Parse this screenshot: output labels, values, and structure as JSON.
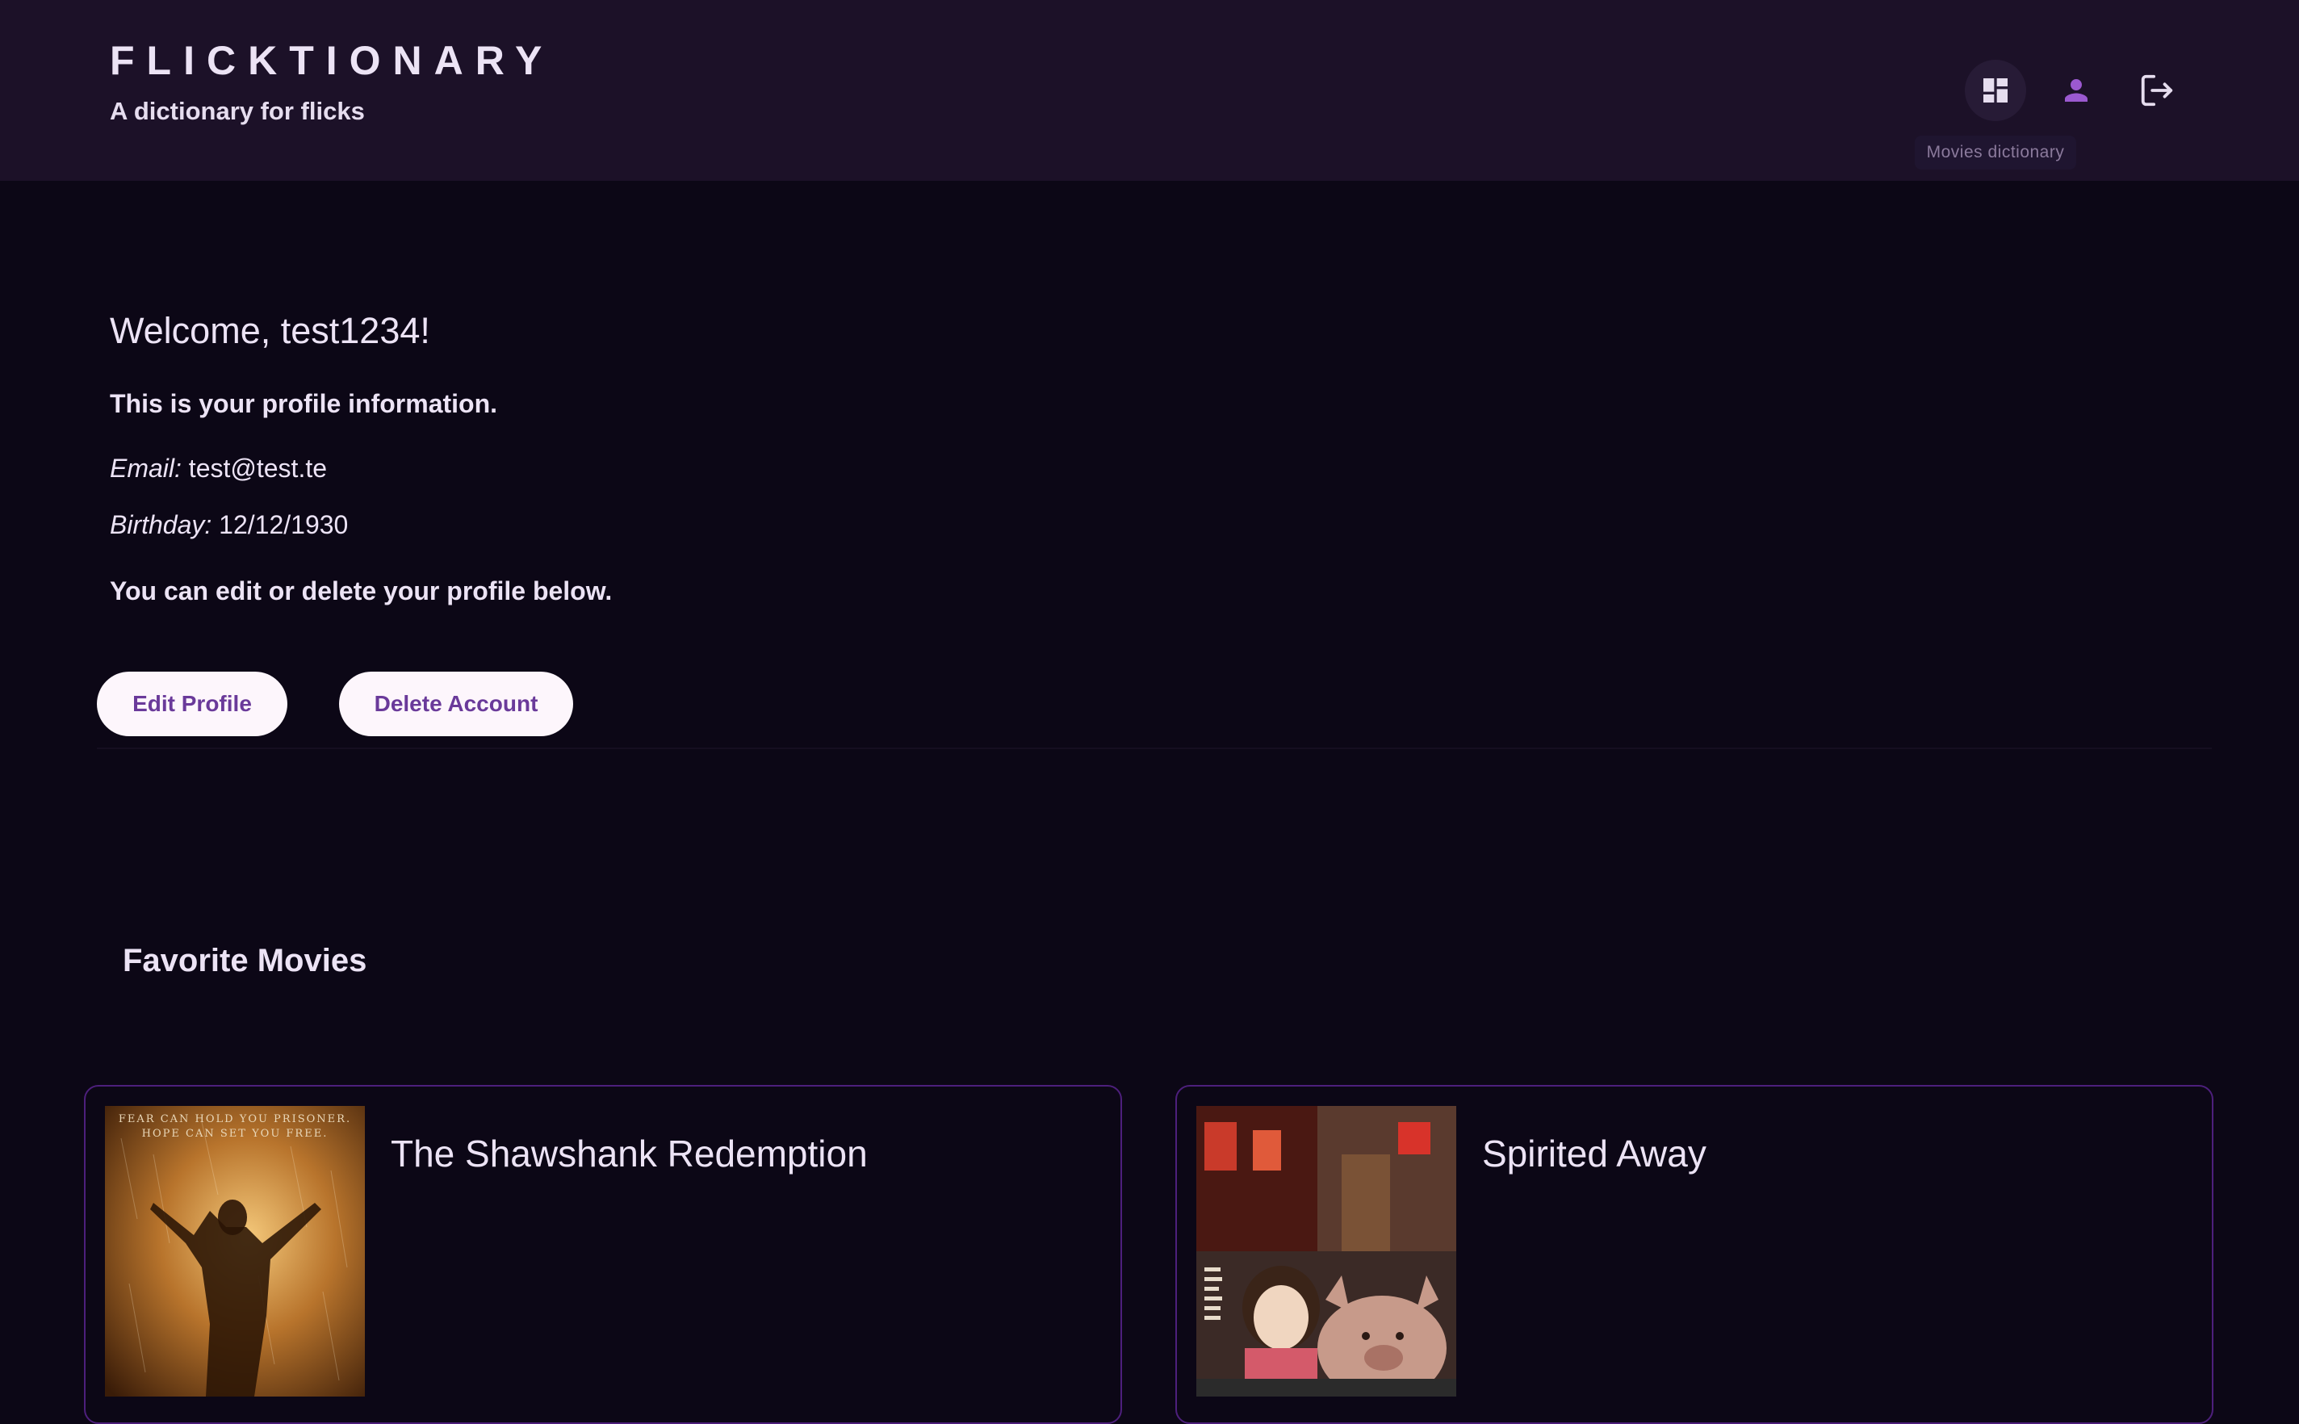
{
  "header": {
    "title": "FLICKTIONARY",
    "subtitle": "A dictionary for flicks",
    "nav": [
      {
        "icon": "dashboard-icon",
        "active": true
      },
      {
        "icon": "person-icon",
        "active": false
      },
      {
        "icon": "logout-icon",
        "active": false
      }
    ],
    "tooltip": "Movies dictionary"
  },
  "profile": {
    "welcome": "Welcome, test1234!",
    "intro": "This is your profile information.",
    "email_label": "Email:",
    "email_value": "test@test.te",
    "birthday_label": "Birthday:",
    "birthday_value": "12/12/1930",
    "edit_note": "You can edit or delete your profile below.",
    "edit_button": "Edit Profile",
    "delete_button": "Delete Account"
  },
  "favorites": {
    "title": "Favorite Movies",
    "movies": [
      {
        "title": "The Shawshank Redemption",
        "poster_tagline": "FEAR CAN HOLD YOU PRISONER. HOPE CAN SET YOU FREE."
      },
      {
        "title": "Spirited Away"
      }
    ]
  },
  "colors": {
    "header_bg": "#1c1128",
    "page_bg": "#0c0716",
    "accent": "#9b59d0",
    "button_bg": "#fdf6fc",
    "button_text": "#6a3a9a",
    "card_border": "#4d1f7c"
  }
}
